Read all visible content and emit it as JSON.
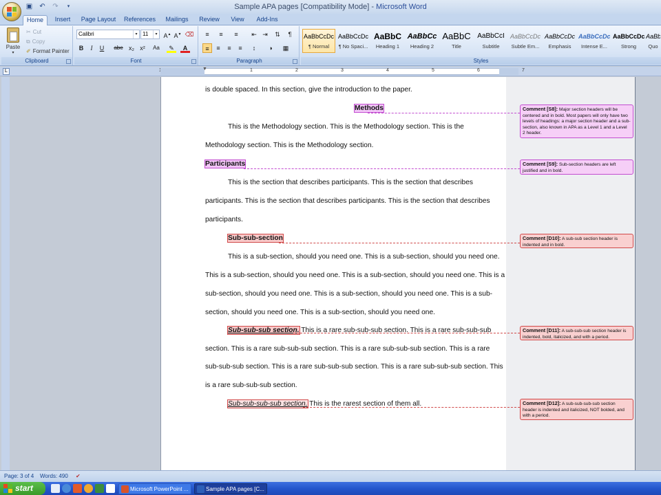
{
  "window": {
    "title": "Sample APA pages [Compatibility Mode]",
    "title_sep": " - ",
    "app_name": "Microsoft Word"
  },
  "ribbon_tabs": [
    "Home",
    "Insert",
    "Page Layout",
    "References",
    "Mailings",
    "Review",
    "View",
    "Add-Ins"
  ],
  "clipboard": {
    "paste": "Paste",
    "cut": "Cut",
    "copy": "Copy",
    "format_painter": "Format Painter",
    "label": "Clipboard"
  },
  "font": {
    "name": "Calibri",
    "size": "11",
    "label": "Font",
    "buttons": [
      "B",
      "I",
      "U",
      "abe",
      "x₂",
      "x²",
      "Aa"
    ]
  },
  "paragraph": {
    "label": "Paragraph"
  },
  "styles": {
    "label": "Styles",
    "items": [
      {
        "preview": "AaBbCcDc",
        "name": "¶ Normal"
      },
      {
        "preview": "AaBbCcDc",
        "name": "¶ No Spaci..."
      },
      {
        "preview": "AaBbC",
        "name": "Heading 1"
      },
      {
        "preview": "AaBbCc",
        "name": "Heading 2"
      },
      {
        "preview": "AaBbC",
        "name": "Title"
      },
      {
        "preview": "AaBbCcI",
        "name": "Subtitle"
      },
      {
        "preview": "AaBbCcDc",
        "name": "Subtle Em..."
      },
      {
        "preview": "AaBbCcDc",
        "name": "Emphasis"
      },
      {
        "preview": "AaBbCcDc",
        "name": "Intense E..."
      },
      {
        "preview": "AaBbCcDc",
        "name": "Strong"
      },
      {
        "preview": "AaBbCcDc",
        "name": "Quo"
      }
    ]
  },
  "ruler_numbers": [
    "1",
    "1",
    "2",
    "3",
    "4",
    "5",
    "6",
    "7"
  ],
  "document": {
    "intro_line": "is double spaced.  In this section, give the introduction to the paper.",
    "methods_heading": "Methods",
    "methods_p1": "This is the Methodology section.   This is the Methodology section.   This is the",
    "methods_p2": "Methodology section.   This is the Methodology section.",
    "participants_heading": "Participants",
    "participants_p1": "This is the section that describes participants.   This is the section that describes",
    "participants_p2": "participants.  This is the section that describes participants.   This is the section that describes",
    "participants_p3": "participants.",
    "subsub_heading": "Sub-sub-section",
    "subsub_p1": "This is a sub-section, should you need one.  This is a sub-section, should you need one.",
    "subsub_p2": "This is a sub-section, should you need one.  This is a sub-section, should you need one.  This is a",
    "subsub_p3": "sub-section, should you need one.  This is a sub-section, should you need one.  This is a sub-",
    "subsub_p4": "section, should you need one.  This is a sub-section, should you need one.",
    "subsubsub_heading": "Sub-sub-sub section.",
    "subsubsub_p1": "  This is a rare sub-sub-sub section.  This is a rare sub-sub-sub",
    "subsubsub_p2": "section.   This is a rare sub-sub-sub  section.  This is a rare sub-sub-sub  section.    This is a rare",
    "subsubsub_p3": "sub-sub-sub  section.  This is a rare sub-sub-sub  section.   This is a rare sub-sub-sub  section.  This",
    "subsubsub_p4": "is a rare sub-sub-sub  section.",
    "subsubsubsub_heading": "Sub-sub-sub-sub section.",
    "subsubsubsub_p1": "  This is the rarest section of them all."
  },
  "comments": [
    {
      "title": "Comment [S8]:",
      "text": " Major section headers will be centered and in bold.  Most papers will only have two levels of headings: a major section header and a sub-section, also known in APA as a Level 1 and a Level 2 header.",
      "color": "#c24cd0"
    },
    {
      "title": "Comment [S9]:",
      "text": " Sub-section headers are left justified and in bold.",
      "color": "#c24cd0"
    },
    {
      "title": "Comment [D10]:",
      "text": " A sub-sub section header is indented and in bold.",
      "color": "#d04848"
    },
    {
      "title": "Comment [D11]:",
      "text": " A sub-sub-sub section header is indented, bold, italicized, and with a period.",
      "color": "#d04848"
    },
    {
      "title": "Comment [D12]:",
      "text": " A sub-sub-sub-sub section header is indented and italicized, NOT bolded, and with a period.",
      "color": "#d04848"
    }
  ],
  "status": {
    "page": "Page: 3 of 4",
    "words": "Words: 490"
  },
  "taskbar": {
    "start": "start",
    "tasks": [
      "Microsoft PowerPoint ...",
      "Sample APA pages [C..."
    ]
  }
}
